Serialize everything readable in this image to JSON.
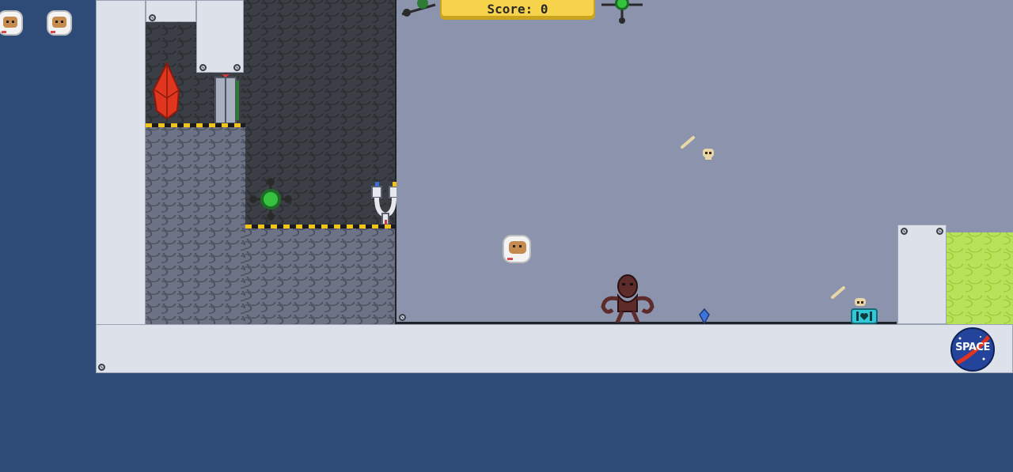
{
  "hud": {
    "score_label": "Score: 0",
    "lives": 2
  },
  "logo": {
    "text": "SPACE"
  },
  "colors": {
    "background": "#2e4b78",
    "room": "#8b93ad",
    "wall": "#dde1ea",
    "acid": "#b7e25a",
    "score_box": "#f6d34a"
  },
  "entities": {
    "player": "astronaut",
    "enemy": "tentacle-monster",
    "pickups": [
      "blue-crystal",
      "heart-chest",
      "bone",
      "skull"
    ],
    "hazards": [
      "red-crystal",
      "green-acid-pool"
    ],
    "objects": [
      "door",
      "green-node",
      "robot-arm"
    ]
  }
}
